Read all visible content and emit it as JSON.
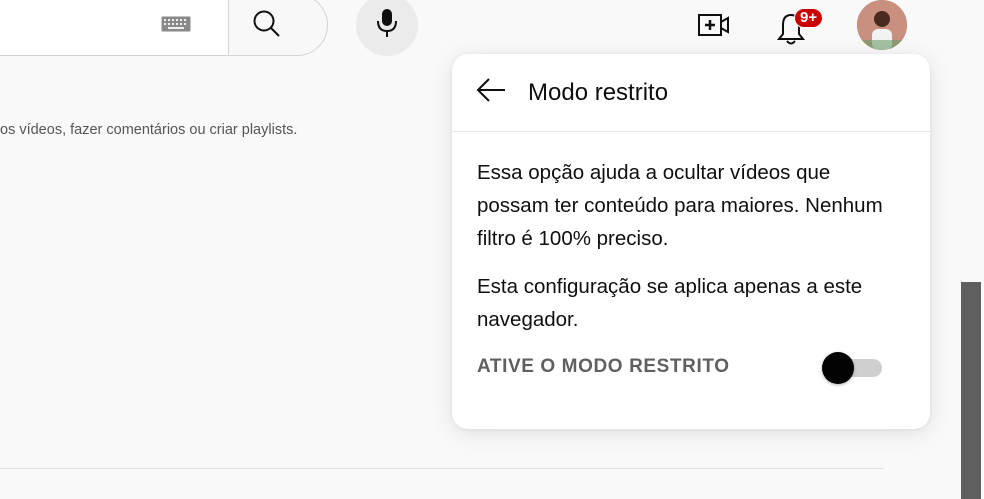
{
  "header": {
    "keyboard_icon": "keyboard-icon",
    "search_icon": "search-icon",
    "mic_icon": "microphone-icon",
    "create_icon": "video-plus-icon",
    "notifications_badge": "9+",
    "notifications_icon": "bell-icon",
    "avatar_icon": "user-avatar"
  },
  "background": {
    "partial_text": "os vídeos, fazer comentários ou criar playlists."
  },
  "popup": {
    "title": "Modo restrito",
    "back_icon": "arrow-left-icon",
    "paragraph_1": "Essa opção ajuda a ocultar vídeos que possam ter conteúdo para maiores. Nenhum filtro é 100% preciso.",
    "paragraph_2": "Esta configuração se aplica apenas a este navegador.",
    "toggle_label": "ATIVE O MODO RESTRITO",
    "toggle_on": false
  },
  "colors": {
    "badge": "#cc0000",
    "toggle_knob": "#030303",
    "toggle_track": "#cfcfcf",
    "scrollbar": "#5f5f5f"
  }
}
